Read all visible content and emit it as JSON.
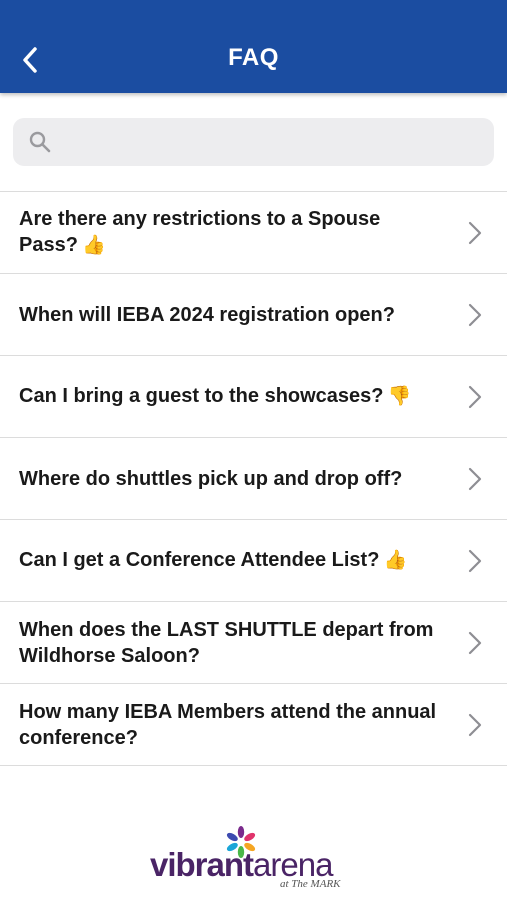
{
  "status_bar": {
    "text": "··· ··· ··· ·"
  },
  "header": {
    "title": "FAQ",
    "back_icon": "chevron-left-icon",
    "background": "#1b4da1"
  },
  "search": {
    "placeholder": "",
    "value": "",
    "icon": "search-icon"
  },
  "faq_items": [
    {
      "question": "Are there any restrictions to a Spouse Pass?",
      "emoji": "👍",
      "icon": "chevron-right-icon"
    },
    {
      "question": "When will IEBA 2024 registration open?",
      "emoji": "",
      "icon": "chevron-right-icon"
    },
    {
      "question": "Can I bring a guest to the showcases?",
      "emoji": "👎",
      "icon": "chevron-right-icon"
    },
    {
      "question": "Where do shuttles pick up and drop off?",
      "emoji": "",
      "icon": "chevron-right-icon"
    },
    {
      "question": "Can I get a Conference Attendee List?",
      "emoji": "👍",
      "icon": "chevron-right-icon"
    },
    {
      "question": "When does the LAST SHUTTLE depart from Wildhorse Saloon?",
      "emoji": "",
      "icon": "chevron-right-icon"
    },
    {
      "question": "How many IEBA Members attend the annual conference?",
      "emoji": "",
      "icon": "chevron-right-icon"
    }
  ],
  "sponsor_logo": {
    "word1": "vibrant",
    "word2": "arena",
    "tagline": "at The MARK",
    "color": "#4a2466"
  }
}
